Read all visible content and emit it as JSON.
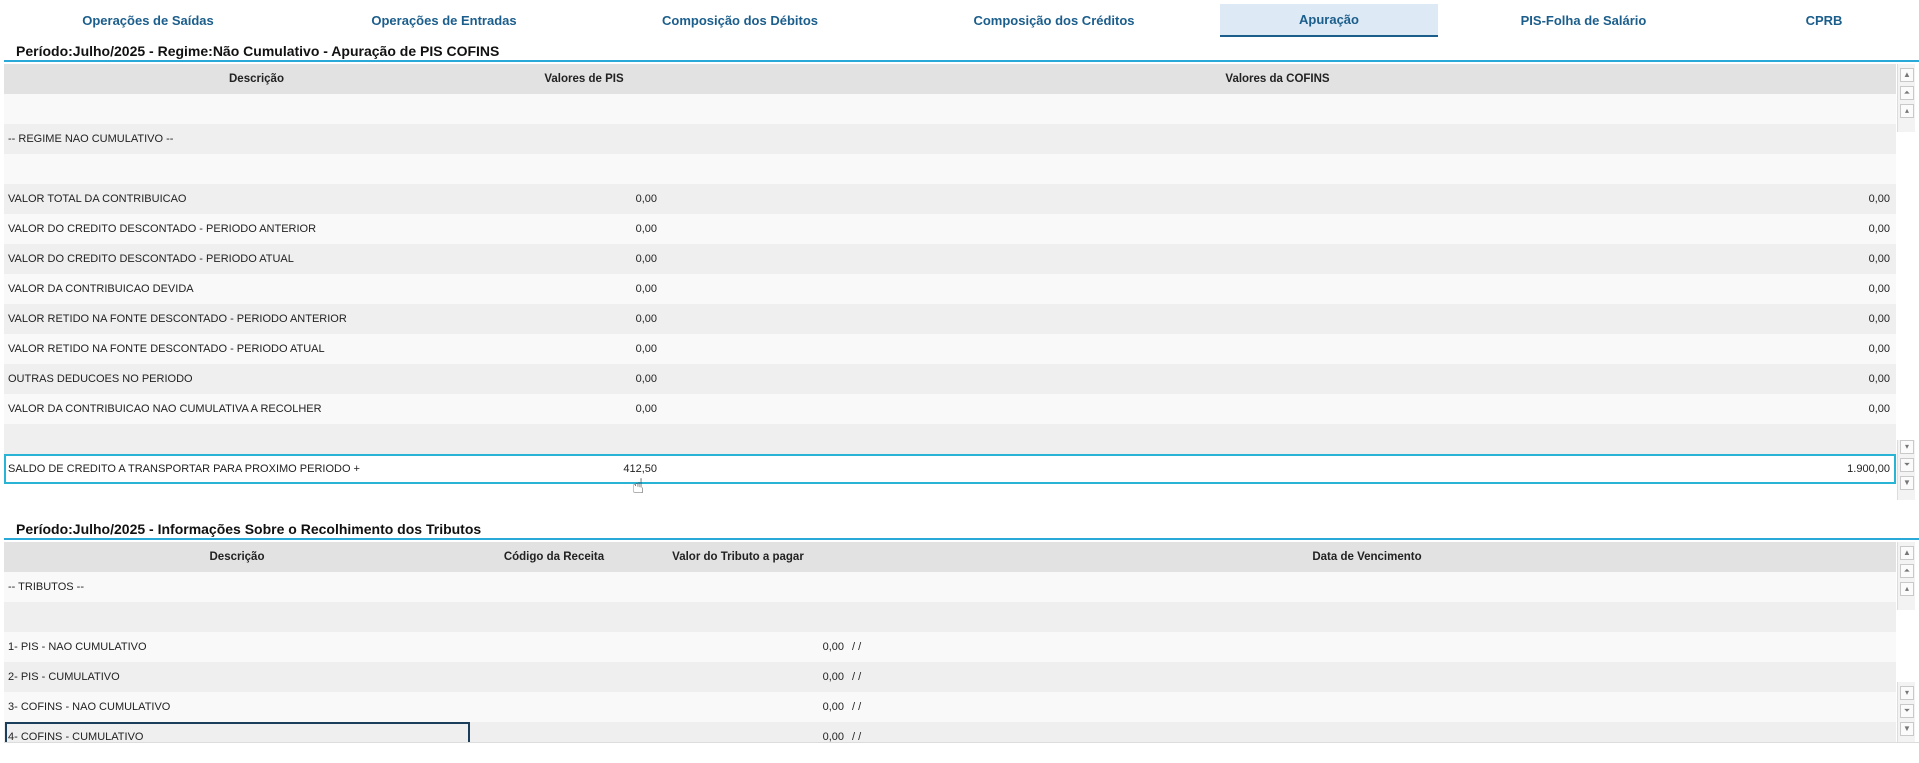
{
  "tabs": [
    {
      "label": "Operações de Saídas"
    },
    {
      "label": "Operações de Entradas"
    },
    {
      "label": "Composição dos Débitos"
    },
    {
      "label": "Composição dos Créditos"
    },
    {
      "label": "Apuração"
    },
    {
      "label": "PIS-Folha de Salário"
    },
    {
      "label": "CPRB"
    }
  ],
  "apuracao": {
    "title": "Período:Julho/2025 - Regime:Não Cumulativo - Apuração de PIS COFINS",
    "columns": {
      "desc": "Descrição",
      "pis": "Valores de PIS",
      "cofins": "Valores da COFINS"
    },
    "rows": [
      {
        "desc": "",
        "pis": "",
        "cofins": ""
      },
      {
        "desc": "-- REGIME NAO CUMULATIVO --",
        "pis": "",
        "cofins": ""
      },
      {
        "desc": "",
        "pis": "",
        "cofins": ""
      },
      {
        "desc": "VALOR TOTAL DA CONTRIBUICAO",
        "pis": "0,00",
        "cofins": "0,00"
      },
      {
        "desc": "VALOR DO CREDITO DESCONTADO - PERIODO ANTERIOR",
        "pis": "0,00",
        "cofins": "0,00"
      },
      {
        "desc": "VALOR DO CREDITO DESCONTADO - PERIODO ATUAL",
        "pis": "0,00",
        "cofins": "0,00"
      },
      {
        "desc": "VALOR DA CONTRIBUICAO DEVIDA",
        "pis": "0,00",
        "cofins": "0,00"
      },
      {
        "desc": "VALOR RETIDO NA FONTE DESCONTADO - PERIODO ANTERIOR",
        "pis": "0,00",
        "cofins": "0,00"
      },
      {
        "desc": "VALOR RETIDO NA FONTE DESCONTADO - PERIODO ATUAL",
        "pis": "0,00",
        "cofins": "0,00"
      },
      {
        "desc": "OUTRAS DEDUCOES NO PERIODO",
        "pis": "0,00",
        "cofins": "0,00"
      },
      {
        "desc": "VALOR DA CONTRIBUICAO NAO CUMULATIVA A RECOLHER",
        "pis": "0,00",
        "cofins": "0,00"
      },
      {
        "desc": "",
        "pis": "",
        "cofins": ""
      },
      {
        "desc": "SALDO DE CREDITO A TRANSPORTAR PARA PROXIMO PERIODO +",
        "pis": "412,50",
        "cofins": "1.900,00"
      }
    ]
  },
  "recolhimento": {
    "title": "Período:Julho/2025 - Informações Sobre o Recolhimento dos Tributos",
    "columns": {
      "desc": "Descrição",
      "codigo": "Código da Receita",
      "valor": "Valor do Tributo a pagar",
      "data": "Data de Vencimento"
    },
    "rows": [
      {
        "desc": "-- TRIBUTOS --",
        "valor": "",
        "data": ""
      },
      {
        "desc": "",
        "valor": "",
        "data": ""
      },
      {
        "desc": "1- PIS - NAO CUMULATIVO",
        "valor": "0,00",
        "data": "/ /"
      },
      {
        "desc": "2- PIS - CUMULATIVO",
        "valor": "0,00",
        "data": "/ /"
      },
      {
        "desc": "3- COFINS - NAO CUMULATIVO",
        "valor": "0,00",
        "data": "/ /"
      },
      {
        "desc": "4- COFINS - CUMULATIVO",
        "valor": "0,00",
        "data": "/ /"
      }
    ]
  }
}
